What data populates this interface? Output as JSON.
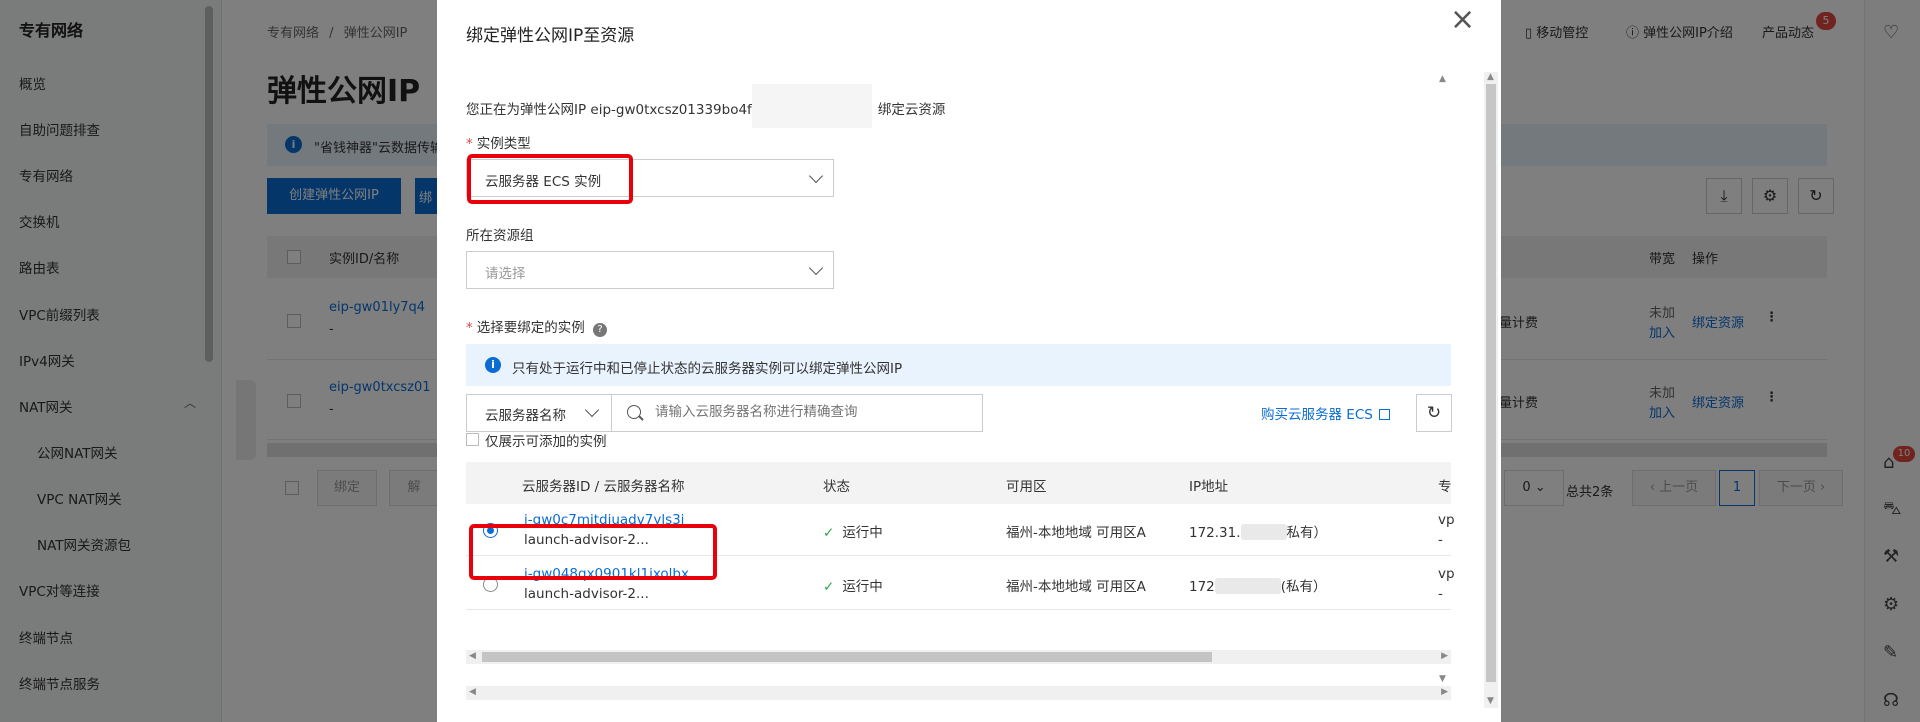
{
  "sidebar": {
    "title": "专有网络",
    "items": [
      {
        "label": "概览"
      },
      {
        "label": "自助问题排查"
      },
      {
        "label": "专有网络"
      },
      {
        "label": "交换机"
      },
      {
        "label": "路由表"
      },
      {
        "label": "VPC前缀列表"
      },
      {
        "label": "IPv4网关"
      },
      {
        "label": "NAT网关"
      },
      {
        "label": "公网NAT网关"
      },
      {
        "label": "VPC NAT网关"
      },
      {
        "label": "NAT网关资源包"
      },
      {
        "label": "VPC对等连接"
      },
      {
        "label": "终端节点"
      },
      {
        "label": "终端节点服务"
      }
    ]
  },
  "main": {
    "breadcrumb": {
      "root": "专有网络",
      "sep": "/",
      "current": "弹性公网IP"
    },
    "title": "弹性公网IP",
    "notice": "\"省钱神器\"云数据传输",
    "create_button": "创建弹性公网IP",
    "second_button": "绑",
    "table_headers": {
      "id": "实例ID/名称",
      "bandwidth": "带宽",
      "action": "操作"
    },
    "rows": [
      {
        "id": "eip-gw01ly7q4",
        "sub": "-",
        "billing": "量计费",
        "status": "未加",
        "status2": "加入",
        "action": "绑定资源"
      },
      {
        "id": "eip-gw0txcsz01",
        "sub": "-",
        "billing": "量计费",
        "status": "未加",
        "status2": "加入",
        "action": "绑定资源"
      }
    ],
    "bulk_buttons": {
      "bind": "绑定",
      "unbind": "解"
    },
    "pager": {
      "size": "0",
      "total": "总共2条",
      "prev": "上一页",
      "page": "1",
      "next": "下一页"
    },
    "top_links": {
      "mobile": "移动管控",
      "eip_intro": "弹性公网IP介绍",
      "news": "产品动态",
      "news_badge": "5"
    },
    "side_badge": "10"
  },
  "dialog": {
    "title": "绑定弹性公网IP至资源",
    "intro_prefix": "您正在为弹性公网IP eip-gw0txcsz01339bo4f",
    "intro_suffix": "绑定云资源",
    "instance_type": {
      "label": "实例类型",
      "value": "云服务器 ECS 实例"
    },
    "resource_group": {
      "label": "所在资源组",
      "placeholder": "请选择"
    },
    "select_instance": {
      "label": "选择要绑定的实例",
      "help": "?"
    },
    "info": "只有处于运行中和已停止状态的云服务器实例可以绑定弹性公网IP",
    "search": {
      "type": "云服务器名称",
      "placeholder": "请输入云服务器名称进行精确查询"
    },
    "buy_link": "购买云服务器 ECS",
    "only_addable": "仅展示可添加的实例",
    "table": {
      "headers": {
        "id": "云服务器ID / 云服务器名称",
        "status": "状态",
        "zone": "可用区",
        "ip": "IP地址",
        "more": "专"
      },
      "rows": [
        {
          "id": "i-gw0c7mitdiuadv7yls3i",
          "name": "launch-advisor-2...",
          "status": "运行中",
          "zone": "福州-本地地域 可用区A",
          "ip_prefix": "172.31.",
          "ip_suffix": "私有）",
          "more": "vp",
          "more2": "-",
          "selected": true
        },
        {
          "id": "i-gw048qx0901kl1ixolbx",
          "name": "launch-advisor-2...",
          "status": "运行中",
          "zone": "福州-本地地域 可用区A",
          "ip_prefix": "172",
          "ip_suffix": "(私有）",
          "more": "vp",
          "more2": "-",
          "selected": false
        }
      ]
    }
  }
}
